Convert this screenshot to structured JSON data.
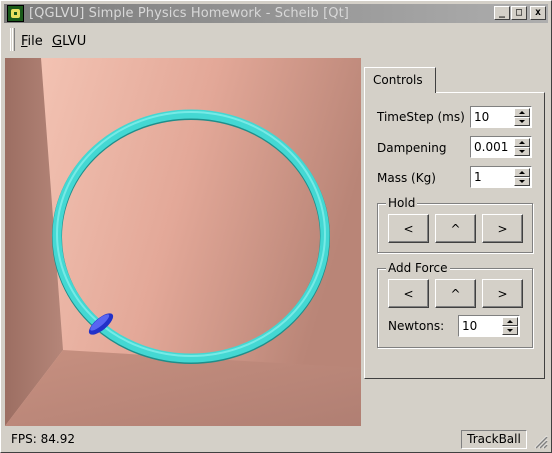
{
  "window": {
    "title": "[QGLVU] Simple Physics Homework - Scheib [Qt]",
    "minimize_label": "_",
    "maximize_label": "□",
    "close_label": "x"
  },
  "menu": {
    "items": [
      {
        "label": "File",
        "mnemonic": "F",
        "rest": "ile"
      },
      {
        "label": "GLVU",
        "mnemonic": "G",
        "rest": "LVU"
      }
    ]
  },
  "viewport": {
    "colors": {
      "background_wall": "#e6ad9e",
      "left_wall": "#a9796d",
      "floor": "#be8a7e",
      "ring": "#44d8d3",
      "bead": "#3646e6"
    }
  },
  "controls": {
    "tab_label": "Controls",
    "timestep": {
      "label": "TimeStep (ms)",
      "value": "10"
    },
    "dampening": {
      "label": "Dampening",
      "value": "0.001"
    },
    "mass": {
      "label": "Mass (Kg)",
      "value": "1"
    },
    "hold": {
      "title": "Hold",
      "left_label": "<",
      "up_label": "^",
      "right_label": ">"
    },
    "add_force": {
      "title": "Add Force",
      "left_label": "<",
      "up_label": "^",
      "right_label": ">",
      "newtons_label": "Newtons:",
      "newtons_value": "10"
    }
  },
  "status": {
    "fps_text": "FPS: 84.92",
    "mode_text": "TrackBall"
  }
}
